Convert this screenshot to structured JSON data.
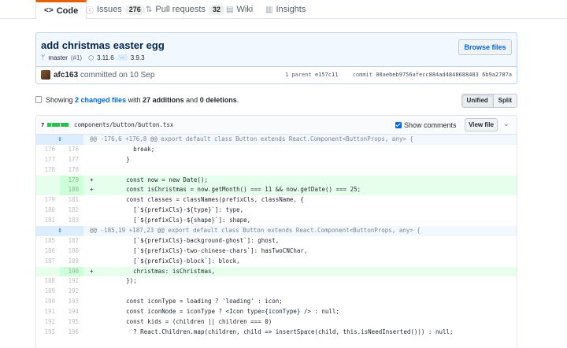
{
  "tabs": [
    {
      "icon": "code-icon",
      "glyph": "<>",
      "label": "Code"
    },
    {
      "icon": "issue-icon",
      "glyph": "ⓘ",
      "label": "Issues",
      "count": "276"
    },
    {
      "icon": "pull-request-icon",
      "glyph": "⇅",
      "label": "Pull requests",
      "count": "32"
    },
    {
      "icon": "wiki-icon",
      "glyph": "▤",
      "label": "Wiki"
    },
    {
      "icon": "graph-icon",
      "glyph": "▥",
      "label": "Insights"
    }
  ],
  "commit": {
    "title": "add christmas easter egg",
    "branch": "master",
    "pr": "(#1)",
    "tag": "3.11.6",
    "dots": "…",
    "tag_end": "3.9.3",
    "browse_label": "Browse files",
    "author": "afc163",
    "committed_text": "committed on 10 Sep",
    "parent_label": "1 parent",
    "parent_sha": "e157c11",
    "commit_label": "commit",
    "commit_sha": "00aebeb9756afecc884ad4848688483 6b9a2787a"
  },
  "toc": {
    "showing": "Showing",
    "changed": "2 changed files",
    "with": "with",
    "additions": "27 additions",
    "and": "and",
    "deletions": "0 deletions",
    "period": ".",
    "unified": "Unified",
    "split": "Split"
  },
  "file": {
    "stat_count": "7",
    "path": "components/button/button.tsx",
    "show_comments": "Show comments",
    "view_file": "View file"
  },
  "diff": {
    "hunk1": "@@ -176,6 +176,8 @@ export default class Button extends React.Component<ButtonProps, any> {",
    "hunk2": "@@ -185,19 +187,23 @@ export default class Button extends React.Component<ButtonProps, any> {",
    "lines": [
      {
        "l": "176",
        "r": "176",
        "code": "          break;"
      },
      {
        "l": "177",
        "r": "177",
        "code": "        }"
      },
      {
        "l": "178",
        "r": "178",
        "code": ""
      },
      {
        "l": "",
        "r": "179",
        "add": true,
        "code": "        const now = new Date();"
      },
      {
        "l": "",
        "r": "180",
        "add": true,
        "code": "        const isChristmas = now.getMonth() === 11 && now.getDate() === 25;"
      },
      {
        "l": "179",
        "r": "181",
        "code": "        const classes = classNames(prefixCls, className, {"
      },
      {
        "l": "180",
        "r": "182",
        "code": "          [`${prefixCls}-${type}`]: type,"
      },
      {
        "l": "181",
        "r": "183",
        "code": "          [`${prefixCls}-${shape}`]: shape,"
      },
      {
        "l": "185",
        "r": "187",
        "code": "          [`${prefixCls}-background-ghost`]: ghost,"
      },
      {
        "l": "186",
        "r": "188",
        "code": "          [`${prefixCls}-two-chinese-chars`]: hasTwoCNChar,"
      },
      {
        "l": "187",
        "r": "189",
        "code": "          [`${prefixCls}-block`]: block,"
      },
      {
        "l": "",
        "r": "190",
        "add": true,
        "code": "          christmas: isChristmas,"
      },
      {
        "l": "188",
        "r": "191",
        "code": "        });"
      },
      {
        "l": "189",
        "r": "192",
        "code": ""
      },
      {
        "l": "190",
        "r": "193",
        "code": "        const iconType = loading ? 'loading' : icon;"
      },
      {
        "l": "191",
        "r": "194",
        "code": "        const iconNode = iconType ? <Icon type={iconType} /> : null;"
      },
      {
        "l": "192",
        "r": "195",
        "code": "        const kids = (children || children === 0)"
      },
      {
        "l": "193",
        "r": "196",
        "code": "          ? React.Children.map(children, child => insertSpace(child, this.isNeedInserted())) : null;"
      }
    ]
  },
  "colors": {
    "accent": "#0366d6",
    "addition_bg": "#e6ffed",
    "addition_num_bg": "#cdffd8",
    "hunk_bg": "#f1f8ff",
    "selected_tab_border": "#e36209",
    "diffstat_green": "#2cbe4e"
  }
}
